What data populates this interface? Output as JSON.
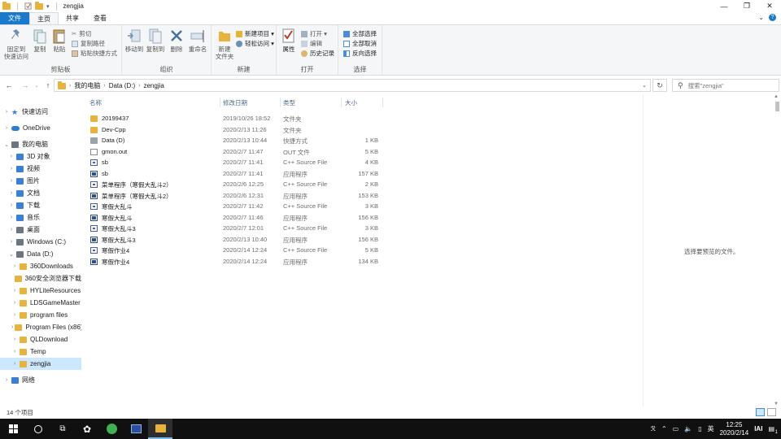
{
  "window": {
    "title": "zengjia",
    "controls": [
      "minimize",
      "maximize",
      "close"
    ]
  },
  "ribbon_tabs": [
    "文件",
    "主页",
    "共享",
    "查看"
  ],
  "ribbon": {
    "clipboard": {
      "label": "剪贴板",
      "pin": "固定到\n快速访问",
      "copy": "复制",
      "paste": "粘贴",
      "cut": "剪切",
      "copy_path": "复制路径",
      "paste_shortcut": "粘贴快捷方式"
    },
    "organize": {
      "label": "组织",
      "move_to": "移动到",
      "copy_to": "复制到",
      "delete": "删除",
      "rename": "重命名"
    },
    "new": {
      "label": "新建",
      "new_folder": "新建\n文件夹",
      "new_item": "新建项目 ▾",
      "easy_access": "轻松访问 ▾"
    },
    "open": {
      "label": "打开",
      "properties": "属性",
      "open": "打开 ▾",
      "edit": "编辑",
      "history": "历史记录"
    },
    "select": {
      "label": "选择",
      "select_all": "全部选择",
      "select_none": "全部取消",
      "invert": "反向选择"
    }
  },
  "address": {
    "crumbs": [
      "我的电脑",
      "Data (D:)",
      "zengjia"
    ],
    "search_placeholder": "搜索\"zengjia\""
  },
  "nav": [
    {
      "label": "快速访问",
      "icon": "star-icon",
      "level": 0,
      "chevron": "›"
    },
    {
      "label": "OneDrive",
      "icon": "cloud-icon",
      "level": 0,
      "chevron": "›"
    },
    {
      "label": "我的电脑",
      "icon": "computer-icon",
      "level": 0,
      "chevron": "⌄"
    },
    {
      "label": "3D 对象",
      "icon": "cube-icon",
      "level": 1,
      "chevron": "›"
    },
    {
      "label": "视频",
      "icon": "video-icon",
      "level": 1,
      "chevron": "›"
    },
    {
      "label": "图片",
      "icon": "picture-icon",
      "level": 1,
      "chevron": "›"
    },
    {
      "label": "文档",
      "icon": "document-icon",
      "level": 1,
      "chevron": "›"
    },
    {
      "label": "下载",
      "icon": "download-icon",
      "level": 1,
      "chevron": "›"
    },
    {
      "label": "音乐",
      "icon": "music-icon",
      "level": 1,
      "chevron": "›"
    },
    {
      "label": "桌面",
      "icon": "desktop-icon",
      "level": 1,
      "chevron": "›"
    },
    {
      "label": "Windows (C:)",
      "icon": "drive-icon",
      "level": 1,
      "chevron": "›"
    },
    {
      "label": "Data (D:)",
      "icon": "drive-icon",
      "level": 1,
      "chevron": "⌄"
    },
    {
      "label": "360Downloads",
      "icon": "folder-icon",
      "level": 2,
      "chevron": "›"
    },
    {
      "label": "360安全浏览器下载",
      "icon": "folder-icon",
      "level": 2,
      "chevron": ""
    },
    {
      "label": "HYLiteResources",
      "icon": "folder-icon",
      "level": 2,
      "chevron": "›"
    },
    {
      "label": "LDSGameMaster",
      "icon": "folder-icon",
      "level": 2,
      "chevron": "›"
    },
    {
      "label": "program files",
      "icon": "folder-icon",
      "level": 2,
      "chevron": "›"
    },
    {
      "label": "Program Files (x86)",
      "icon": "folder-icon",
      "level": 2,
      "chevron": "›"
    },
    {
      "label": "QLDownload",
      "icon": "folder-icon",
      "level": 2,
      "chevron": "›"
    },
    {
      "label": "Temp",
      "icon": "folder-icon",
      "level": 2,
      "chevron": "›"
    },
    {
      "label": "zengjia",
      "icon": "folder-icon",
      "level": 2,
      "chevron": "›",
      "selected": true
    },
    {
      "label": "网络",
      "icon": "network-icon",
      "level": 0,
      "chevron": "›"
    }
  ],
  "columns": {
    "name": "名称",
    "date": "修改日期",
    "type": "类型",
    "size": "大小"
  },
  "files": [
    {
      "name": "20199437",
      "date": "2019/10/26 18:52",
      "type": "文件夹",
      "size": "",
      "kind": "folder"
    },
    {
      "name": "Dev-Cpp",
      "date": "2020/2/13 11:26",
      "type": "文件夹",
      "size": "",
      "kind": "folder"
    },
    {
      "name": "Data (D)",
      "date": "2020/2/13 10:44",
      "type": "快捷方式",
      "size": "1 KB",
      "kind": "lnk"
    },
    {
      "name": "gmon.out",
      "date": "2020/2/7 11:47",
      "type": "OUT 文件",
      "size": "5 KB",
      "kind": "file"
    },
    {
      "name": "sb",
      "date": "2020/2/7 11:41",
      "type": "C++ Source File",
      "size": "4 KB",
      "kind": "cpp"
    },
    {
      "name": "sb",
      "date": "2020/2/7 11:41",
      "type": "应用程序",
      "size": "157 KB",
      "kind": "exe"
    },
    {
      "name": "菜单程序（寒假大乱斗2）",
      "date": "2020/2/6 12:25",
      "type": "C++ Source File",
      "size": "2 KB",
      "kind": "cpp"
    },
    {
      "name": "菜单程序（寒假大乱斗2）",
      "date": "2020/2/6 12:31",
      "type": "应用程序",
      "size": "153 KB",
      "kind": "exe"
    },
    {
      "name": "寒假大乱斗",
      "date": "2020/2/7 11:42",
      "type": "C++ Source File",
      "size": "3 KB",
      "kind": "cpp"
    },
    {
      "name": "寒假大乱斗",
      "date": "2020/2/7 11:46",
      "type": "应用程序",
      "size": "156 KB",
      "kind": "exe"
    },
    {
      "name": "寒假大乱斗3",
      "date": "2020/2/7 12:01",
      "type": "C++ Source File",
      "size": "3 KB",
      "kind": "cpp"
    },
    {
      "name": "寒假大乱斗3",
      "date": "2020/2/13 10:40",
      "type": "应用程序",
      "size": "156 KB",
      "kind": "exe"
    },
    {
      "name": "寒假作业4",
      "date": "2020/2/14 12:24",
      "type": "C++ Source File",
      "size": "5 KB",
      "kind": "cpp"
    },
    {
      "name": "寒假作业4",
      "date": "2020/2/14 12:24",
      "type": "应用程序",
      "size": "134 KB",
      "kind": "exe"
    }
  ],
  "preview_text": "选择要预览的文件。",
  "status": {
    "item_count": "14 个项目"
  },
  "taskbar": {
    "time": "12:25",
    "date": "2020/2/14",
    "ime": "英",
    "notification_badge": "1"
  },
  "colors": {
    "accent": "#1979ca",
    "selection": "#cce8ff",
    "folder": "#e8b33a",
    "taskbar": "#101010"
  }
}
